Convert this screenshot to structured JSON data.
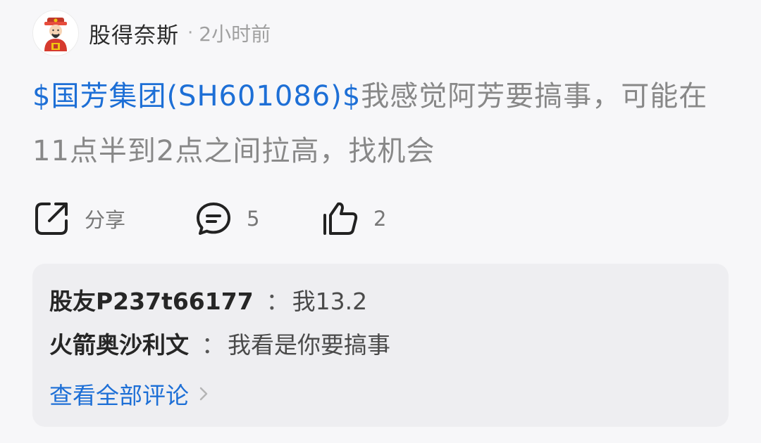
{
  "post": {
    "author": "股得奈斯",
    "separator": "·",
    "time": "2小时前",
    "stock_tag": "$国芳集团(SH601086)$",
    "content": "我感觉阿芳要搞事，可能在11点半到2点之间拉高，找机会"
  },
  "actions": {
    "share_label": "分享",
    "comment_count": "5",
    "like_count": "2"
  },
  "comments": [
    {
      "user": "股友P237t66177",
      "colon": "：",
      "text": "我13.2"
    },
    {
      "user": "火箭奥沙利文",
      "colon": "：",
      "text": "我看是你要搞事"
    }
  ],
  "view_all_comments": "查看全部评论",
  "colors": {
    "link": "#1d6fd6",
    "body_text": "#888888",
    "background": "#f7f7f9",
    "card": "#eeeef1"
  },
  "icons": {
    "avatar": "god-of-wealth-avatar",
    "share": "share-icon",
    "comment": "comment-icon",
    "like": "thumbs-up-icon",
    "chevron": "chevron-right-icon"
  }
}
